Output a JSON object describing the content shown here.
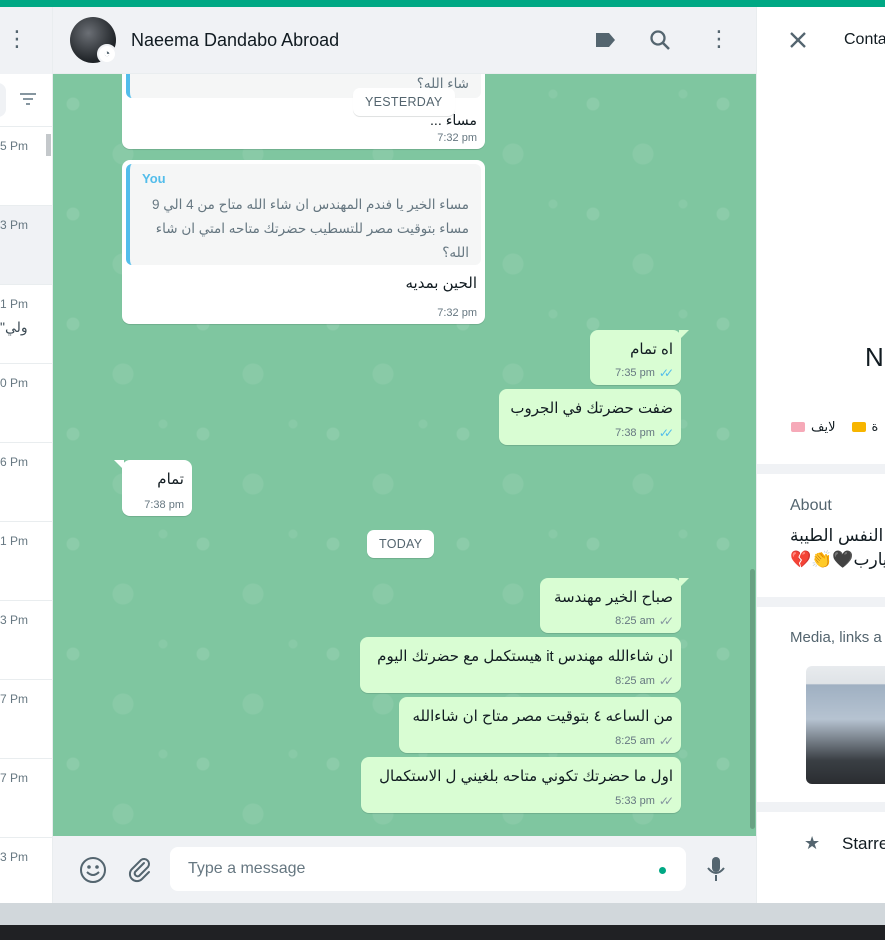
{
  "chat": {
    "contact_name": "Naeema Dandabo Abroad",
    "input_placeholder": "Type a message",
    "date_chips": [
      "YESTERDAY",
      "TODAY"
    ],
    "messages": [
      {
        "dir": "in",
        "partial_quote": "شاء الله؟",
        "text": "مساء ...",
        "time": "7:32 pm"
      },
      {
        "dir": "in",
        "quote_author": "You",
        "quote_text": "مساء  الخير يا فندم المهندس ان شاء الله متاح من 4 الي 9 مساء   بتوقيت مصر للتسطيب حضرتك  متاحه امتي ان شاء الله؟",
        "text": "الحين بمديه",
        "time": "7:32 pm"
      },
      {
        "dir": "out",
        "text": "اه تمام",
        "time": "7:35 pm",
        "status": "read"
      },
      {
        "dir": "out",
        "text": "ضفت حضرتك في الجروب",
        "time": "7:38 pm",
        "status": "read"
      },
      {
        "dir": "in",
        "text": "تمام",
        "time": "7:38 pm"
      },
      {
        "dir": "out",
        "text": "صباح الخير مهندسة",
        "time": "8:25 am",
        "status": "delivered"
      },
      {
        "dir": "out",
        "text": "ان شاءالله مهندس it هيستكمل مع حضرتك اليوم",
        "time": "8:25 am",
        "status": "delivered"
      },
      {
        "dir": "out",
        "text": "من الساعه  ٤ بتوقيت مصر متاح ان شاءالله",
        "time": "8:25 am",
        "status": "delivered"
      },
      {
        "dir": "out",
        "text": "اول ما حضرتك تكوني متاحه بلغيني ل الاستكمال",
        "time": "5:33 pm",
        "status": "delivered"
      }
    ]
  },
  "left_list": {
    "items": [
      {
        "time": "5 Pm",
        "snippet": ""
      },
      {
        "time": "3 Pm",
        "snippet": ""
      },
      {
        "time": "1 Pm",
        "snippet": "\"ولي"
      },
      {
        "time": "0 Pm",
        "snippet": ""
      },
      {
        "time": "6 Pm",
        "snippet": ""
      },
      {
        "time": "1 Pm",
        "snippet": ""
      },
      {
        "time": "3 Pm",
        "snippet": ""
      },
      {
        "time": "7 Pm",
        "snippet": ""
      },
      {
        "time": "7 Pm",
        "snippet": ""
      },
      {
        "time": "3 Pm",
        "snippet": ""
      }
    ]
  },
  "contact_info": {
    "title": "Conta",
    "name_partial": "N",
    "labels": [
      "لايف",
      "ة"
    ],
    "about_heading": "About",
    "about_line1": "النفس الطيبة",
    "about_line2": "💔👏🖤يارب",
    "media_heading": "Media, links a",
    "starred": "Starre"
  },
  "colors": {
    "accent": "#00a884",
    "outgoing_bubble": "#d9fdd3",
    "read_tick": "#53bdeb",
    "wallpaper": "#7fc6a0"
  }
}
